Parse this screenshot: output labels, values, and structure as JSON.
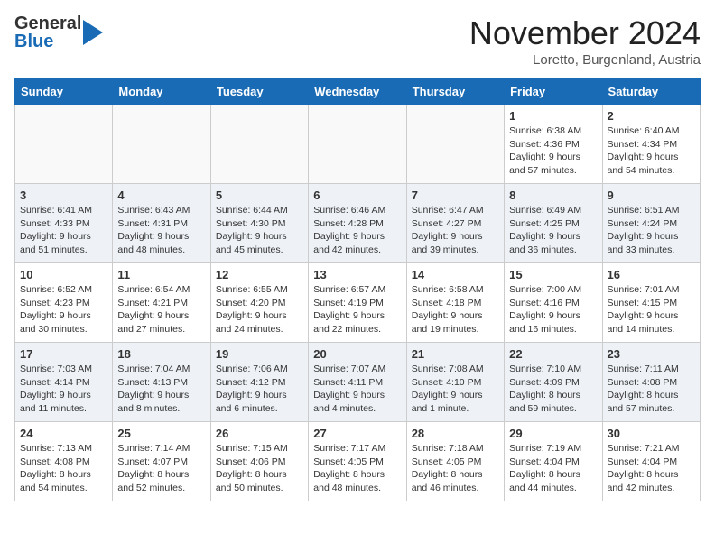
{
  "header": {
    "logo_general": "General",
    "logo_blue": "Blue",
    "month_title": "November 2024",
    "location": "Loretto, Burgenland, Austria"
  },
  "weekdays": [
    "Sunday",
    "Monday",
    "Tuesday",
    "Wednesday",
    "Thursday",
    "Friday",
    "Saturday"
  ],
  "weeks": [
    [
      {
        "day": "",
        "info": ""
      },
      {
        "day": "",
        "info": ""
      },
      {
        "day": "",
        "info": ""
      },
      {
        "day": "",
        "info": ""
      },
      {
        "day": "",
        "info": ""
      },
      {
        "day": "1",
        "info": "Sunrise: 6:38 AM\nSunset: 4:36 PM\nDaylight: 9 hours\nand 57 minutes."
      },
      {
        "day": "2",
        "info": "Sunrise: 6:40 AM\nSunset: 4:34 PM\nDaylight: 9 hours\nand 54 minutes."
      }
    ],
    [
      {
        "day": "3",
        "info": "Sunrise: 6:41 AM\nSunset: 4:33 PM\nDaylight: 9 hours\nand 51 minutes."
      },
      {
        "day": "4",
        "info": "Sunrise: 6:43 AM\nSunset: 4:31 PM\nDaylight: 9 hours\nand 48 minutes."
      },
      {
        "day": "5",
        "info": "Sunrise: 6:44 AM\nSunset: 4:30 PM\nDaylight: 9 hours\nand 45 minutes."
      },
      {
        "day": "6",
        "info": "Sunrise: 6:46 AM\nSunset: 4:28 PM\nDaylight: 9 hours\nand 42 minutes."
      },
      {
        "day": "7",
        "info": "Sunrise: 6:47 AM\nSunset: 4:27 PM\nDaylight: 9 hours\nand 39 minutes."
      },
      {
        "day": "8",
        "info": "Sunrise: 6:49 AM\nSunset: 4:25 PM\nDaylight: 9 hours\nand 36 minutes."
      },
      {
        "day": "9",
        "info": "Sunrise: 6:51 AM\nSunset: 4:24 PM\nDaylight: 9 hours\nand 33 minutes."
      }
    ],
    [
      {
        "day": "10",
        "info": "Sunrise: 6:52 AM\nSunset: 4:23 PM\nDaylight: 9 hours\nand 30 minutes."
      },
      {
        "day": "11",
        "info": "Sunrise: 6:54 AM\nSunset: 4:21 PM\nDaylight: 9 hours\nand 27 minutes."
      },
      {
        "day": "12",
        "info": "Sunrise: 6:55 AM\nSunset: 4:20 PM\nDaylight: 9 hours\nand 24 minutes."
      },
      {
        "day": "13",
        "info": "Sunrise: 6:57 AM\nSunset: 4:19 PM\nDaylight: 9 hours\nand 22 minutes."
      },
      {
        "day": "14",
        "info": "Sunrise: 6:58 AM\nSunset: 4:18 PM\nDaylight: 9 hours\nand 19 minutes."
      },
      {
        "day": "15",
        "info": "Sunrise: 7:00 AM\nSunset: 4:16 PM\nDaylight: 9 hours\nand 16 minutes."
      },
      {
        "day": "16",
        "info": "Sunrise: 7:01 AM\nSunset: 4:15 PM\nDaylight: 9 hours\nand 14 minutes."
      }
    ],
    [
      {
        "day": "17",
        "info": "Sunrise: 7:03 AM\nSunset: 4:14 PM\nDaylight: 9 hours\nand 11 minutes."
      },
      {
        "day": "18",
        "info": "Sunrise: 7:04 AM\nSunset: 4:13 PM\nDaylight: 9 hours\nand 8 minutes."
      },
      {
        "day": "19",
        "info": "Sunrise: 7:06 AM\nSunset: 4:12 PM\nDaylight: 9 hours\nand 6 minutes."
      },
      {
        "day": "20",
        "info": "Sunrise: 7:07 AM\nSunset: 4:11 PM\nDaylight: 9 hours\nand 4 minutes."
      },
      {
        "day": "21",
        "info": "Sunrise: 7:08 AM\nSunset: 4:10 PM\nDaylight: 9 hours\nand 1 minute."
      },
      {
        "day": "22",
        "info": "Sunrise: 7:10 AM\nSunset: 4:09 PM\nDaylight: 8 hours\nand 59 minutes."
      },
      {
        "day": "23",
        "info": "Sunrise: 7:11 AM\nSunset: 4:08 PM\nDaylight: 8 hours\nand 57 minutes."
      }
    ],
    [
      {
        "day": "24",
        "info": "Sunrise: 7:13 AM\nSunset: 4:08 PM\nDaylight: 8 hours\nand 54 minutes."
      },
      {
        "day": "25",
        "info": "Sunrise: 7:14 AM\nSunset: 4:07 PM\nDaylight: 8 hours\nand 52 minutes."
      },
      {
        "day": "26",
        "info": "Sunrise: 7:15 AM\nSunset: 4:06 PM\nDaylight: 8 hours\nand 50 minutes."
      },
      {
        "day": "27",
        "info": "Sunrise: 7:17 AM\nSunset: 4:05 PM\nDaylight: 8 hours\nand 48 minutes."
      },
      {
        "day": "28",
        "info": "Sunrise: 7:18 AM\nSunset: 4:05 PM\nDaylight: 8 hours\nand 46 minutes."
      },
      {
        "day": "29",
        "info": "Sunrise: 7:19 AM\nSunset: 4:04 PM\nDaylight: 8 hours\nand 44 minutes."
      },
      {
        "day": "30",
        "info": "Sunrise: 7:21 AM\nSunset: 4:04 PM\nDaylight: 8 hours\nand 42 minutes."
      }
    ]
  ]
}
